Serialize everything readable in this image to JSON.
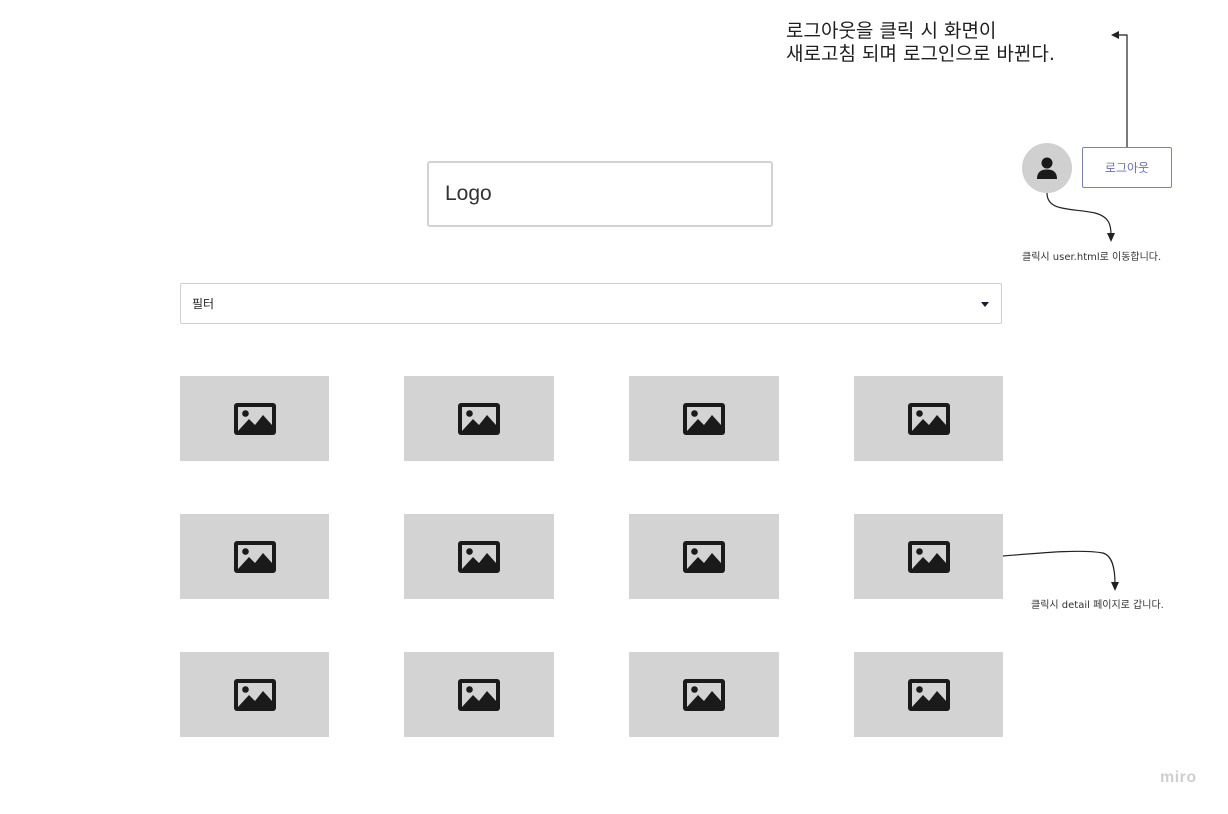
{
  "annotations": {
    "logout_note": [
      "로그아웃을 클릭 시 화면이",
      "새로고침 되며 로그인으로 바뀐다."
    ],
    "avatar_note": "클릭시 user.html로 이동합니다.",
    "tile_note": "클릭시 detail 페이지로 갑니다."
  },
  "header": {
    "logo_text": "Logo",
    "logout_label": "로그아웃",
    "avatar_icon": "user-icon"
  },
  "filter": {
    "selected": "필터"
  },
  "gallery": {
    "tile_icon": "image-icon",
    "tiles": [
      {
        "icon": "image-icon"
      },
      {
        "icon": "image-icon"
      },
      {
        "icon": "image-icon"
      },
      {
        "icon": "image-icon"
      },
      {
        "icon": "image-icon"
      },
      {
        "icon": "image-icon"
      },
      {
        "icon": "image-icon"
      },
      {
        "icon": "image-icon"
      },
      {
        "icon": "image-icon"
      },
      {
        "icon": "image-icon"
      },
      {
        "icon": "image-icon"
      },
      {
        "icon": "image-icon"
      }
    ]
  },
  "watermark": "miro",
  "colors": {
    "tile_bg": "#d3d3d3",
    "button_border": "#7d7fb8",
    "avatar_bg": "#d0d0d0"
  }
}
